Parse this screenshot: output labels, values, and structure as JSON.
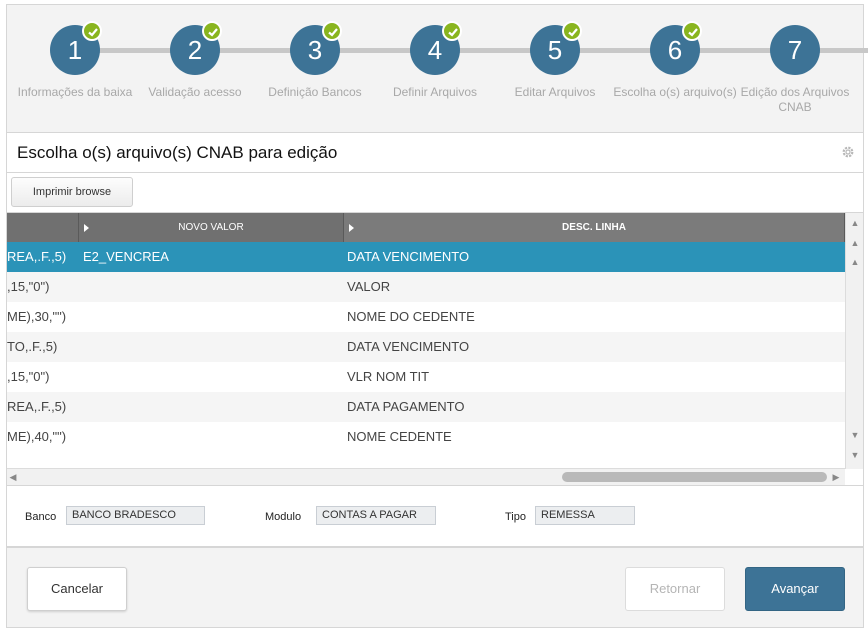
{
  "wizard": {
    "steps": [
      {
        "number": "1",
        "label": "Informações da baixa",
        "done": true
      },
      {
        "number": "2",
        "label": "Validação acesso",
        "done": true
      },
      {
        "number": "3",
        "label": "Definição Bancos",
        "done": true
      },
      {
        "number": "4",
        "label": "Definir Arquivos",
        "done": true
      },
      {
        "number": "5",
        "label": "Editar Arquivos",
        "done": true
      },
      {
        "number": "6",
        "label": "Escolha o(s) arquivo(s)",
        "done": true
      },
      {
        "number": "7",
        "label": "Edição dos Arquivos CNAB",
        "done": false
      }
    ]
  },
  "page": {
    "title": "Escolha o(s) arquivo(s) CNAB para edição"
  },
  "toolbar": {
    "print_label": "Imprimir browse"
  },
  "grid": {
    "columns": [
      {
        "label": ""
      },
      {
        "label": "NOVO VALOR"
      },
      {
        "label": "DESC. LINHA"
      }
    ],
    "rows": [
      {
        "c1": "REA,.F.,5)",
        "c2": "E2_VENCREA",
        "c3": "DATA VENCIMENTO",
        "selected": true
      },
      {
        "c1": ",15,\"0\")",
        "c2": "",
        "c3": "VALOR",
        "selected": false
      },
      {
        "c1": "ME),30,\"\")",
        "c2": "",
        "c3": "NOME DO CEDENTE",
        "selected": false
      },
      {
        "c1": "TO,.F.,5)",
        "c2": "",
        "c3": "DATA VENCIMENTO",
        "selected": false
      },
      {
        "c1": ",15,\"0\")",
        "c2": "",
        "c3": "VLR NOM TIT",
        "selected": false
      },
      {
        "c1": "REA,.F.,5)",
        "c2": "",
        "c3": "DATA PAGAMENTO",
        "selected": false
      },
      {
        "c1": "ME),40,\"\")",
        "c2": "",
        "c3": "NOME CEDENTE",
        "selected": false
      }
    ]
  },
  "info": {
    "banco_label": "Banco",
    "banco_value": "BANCO BRADESCO",
    "modulo_label": "Modulo",
    "modulo_value": "CONTAS A PAGAR",
    "tipo_label": "Tipo",
    "tipo_value": "REMESSA"
  },
  "footer": {
    "cancel_label": "Cancelar",
    "back_label": "Retornar",
    "next_label": "Avançar"
  },
  "colors": {
    "step": "#3d7396",
    "check": "#8ab51f",
    "selected_row": "#2b93b8",
    "primary_button": "#3d7396"
  }
}
